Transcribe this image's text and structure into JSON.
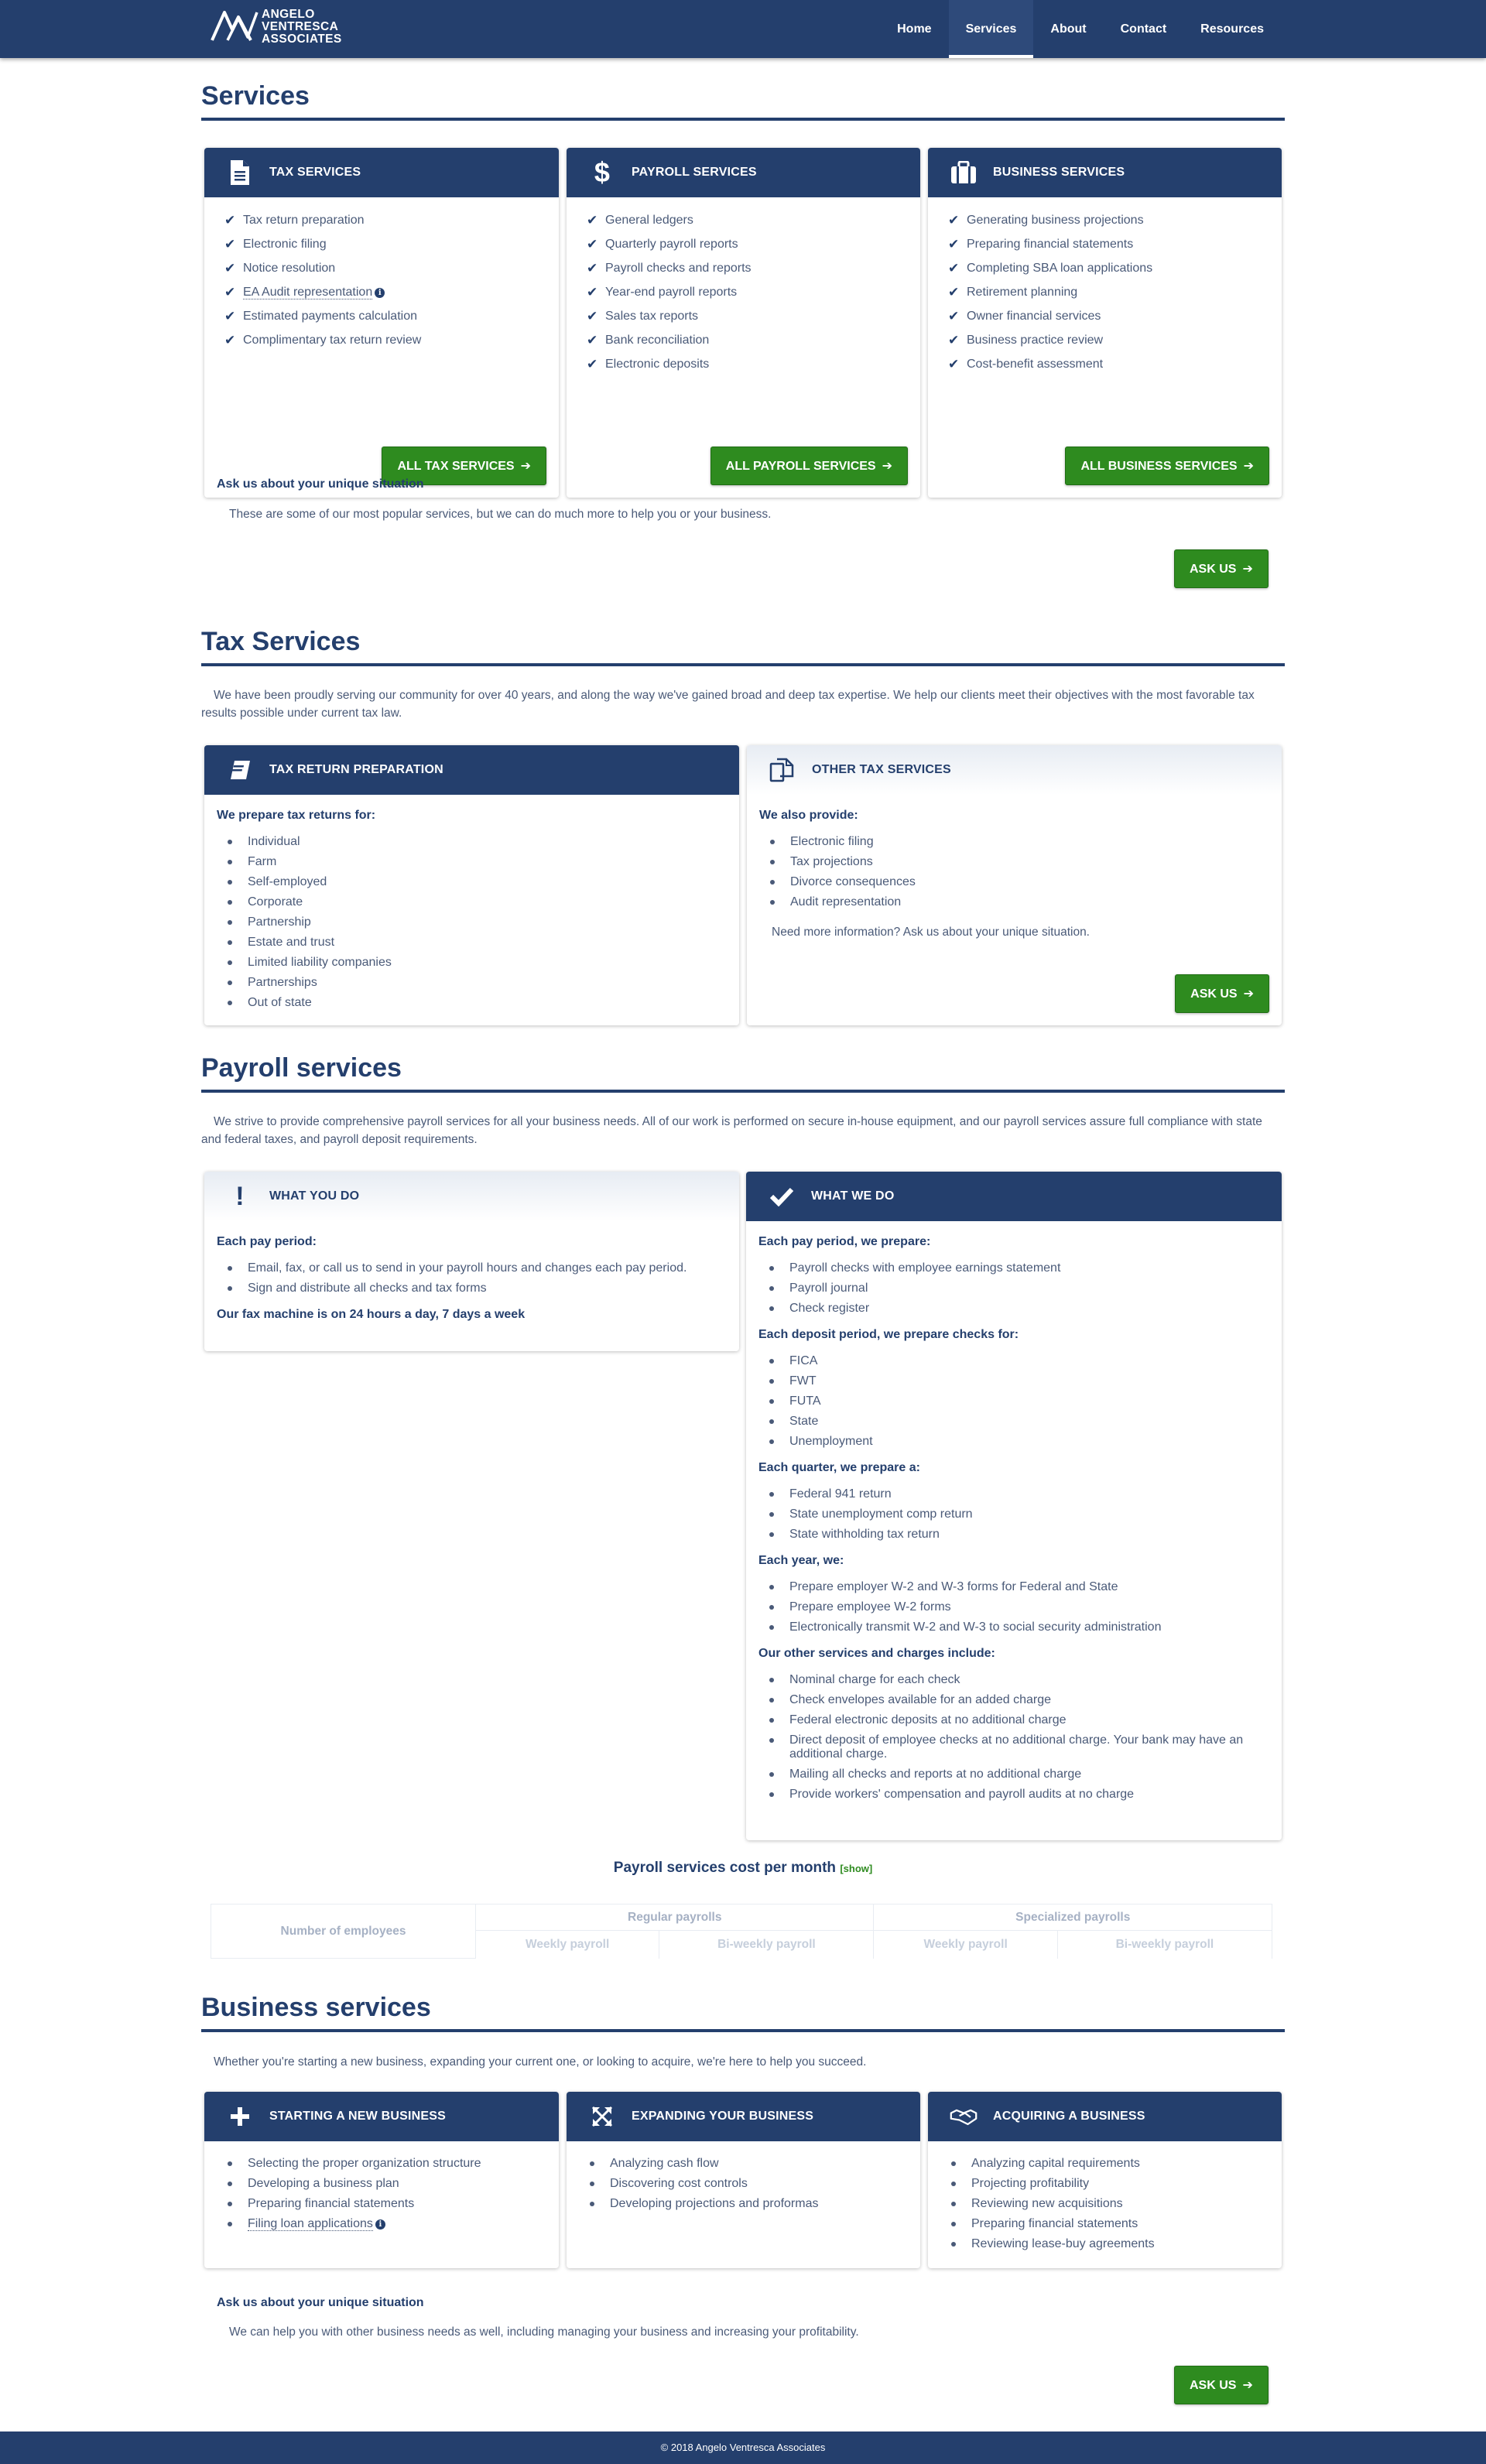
{
  "brand": {
    "line1": "ANGELO",
    "line2": "VENTRESCA",
    "line3": "ASSOCIATES"
  },
  "nav": {
    "home": "Home",
    "services": "Services",
    "about": "About",
    "contact": "Contact",
    "resources": "Resources"
  },
  "overview": {
    "title": "Services",
    "cards": [
      {
        "title": "TAX SERVICES",
        "icon": "document-icon",
        "items": [
          "Tax return preparation",
          "Electronic filing",
          "Notice resolution",
          "EA Audit representation",
          "Estimated payments calculation",
          "Complimentary tax return review"
        ],
        "button": "ALL TAX SERVICES"
      },
      {
        "title": "PAYROLL SERVICES",
        "icon": "dollar-icon",
        "items": [
          "General ledgers",
          "Quarterly payroll reports",
          "Payroll checks and reports",
          "Year-end payroll reports",
          "Sales tax reports",
          "Bank reconciliation",
          "Electronic deposits"
        ],
        "button": "ALL PAYROLL SERVICES"
      },
      {
        "title": "BUSINESS SERVICES",
        "icon": "briefcase-icon",
        "items": [
          "Generating business projections",
          "Preparing financial statements",
          "Completing SBA loan applications",
          "Retirement planning",
          "Owner financial services",
          "Business practice review",
          "Cost-benefit assessment"
        ],
        "button": "ALL BUSINESS SERVICES"
      }
    ],
    "ask_heading": "Ask us about your unique situation",
    "ask_text": "These are some of our most popular services, but we can do much more to help you or your business.",
    "ask_button": "ASK US"
  },
  "tax": {
    "title": "Tax Services",
    "intro": "We have been proudly serving our community for over 40 years, and along the way we've gained broad and deep tax expertise. We help our clients meet their objectives with the most favorable tax results possible under current tax law.",
    "prep": {
      "title": "TAX RETURN PREPARATION",
      "subhead": "We prepare tax returns for:",
      "items": [
        "Individual",
        "Farm",
        "Self-employed",
        "Corporate",
        "Partnership",
        "Estate and trust",
        "Limited liability companies",
        "Partnerships",
        "Out of state"
      ]
    },
    "other": {
      "title": "OTHER TAX SERVICES",
      "subhead": "We also provide:",
      "items": [
        "Electronic filing",
        "Tax projections",
        "Divorce consequences",
        "Audit representation"
      ],
      "note": "Need more information? Ask us about your unique situation.",
      "button": "ASK US"
    }
  },
  "payroll": {
    "title": "Payroll services",
    "intro": "We strive to provide comprehensive payroll services for all your business needs. All of our work is performed on secure in-house equipment, and our payroll services assure full compliance with state and federal taxes, and payroll deposit requirements.",
    "you": {
      "title": "WHAT YOU DO",
      "subhead": "Each pay period:",
      "items": [
        "Email, fax, or call us to send in your payroll hours and changes each pay period.",
        "Sign and distribute all checks and tax forms"
      ],
      "note": "Our fax machine is on 24 hours a day, 7 days a week"
    },
    "we": {
      "title": "WHAT WE DO",
      "groups": [
        {
          "subhead": "Each pay period, we prepare:",
          "items": [
            "Payroll checks with employee earnings statement",
            "Payroll journal",
            "Check register"
          ]
        },
        {
          "subhead": "Each deposit period, we prepare checks for:",
          "items": [
            "FICA",
            "FWT",
            "FUTA",
            "State",
            "Unemployment"
          ]
        },
        {
          "subhead": "Each quarter, we prepare a:",
          "items": [
            "Federal 941 return",
            "State unemployment comp return",
            "State withholding tax return"
          ]
        },
        {
          "subhead": "Each year, we:",
          "items": [
            "Prepare employer W-2 and W-3 forms for Federal and State",
            "Prepare employee W-2 forms",
            "Electronically transmit W-2 and W-3 to social security administration"
          ]
        },
        {
          "subhead": "Our other services and charges include:",
          "items": [
            "Nominal charge for each check",
            "Check envelopes available for an added charge",
            "Federal electronic deposits at no additional charge",
            "Direct deposit of employee checks at no additional charge. Your bank may have an additional charge.",
            "Mailing all checks and reports at no additional charge",
            "Provide workers' compensation and payroll audits at no charge"
          ]
        }
      ]
    },
    "cost": {
      "title": "Payroll services cost per month",
      "show": "[show]",
      "col_employees": "Number of employees",
      "col_regular": "Regular payrolls",
      "col_special": "Specialized payrolls",
      "weekly": "Weekly payroll",
      "biweekly": "Bi-weekly payroll"
    }
  },
  "business": {
    "title": "Business services",
    "intro": "Whether you're starting a new business, expanding your current one, or looking to acquire, we're here to help you succeed.",
    "cards": [
      {
        "title": "STARTING A NEW BUSINESS",
        "icon": "plus-icon",
        "items": [
          "Selecting the proper organization structure",
          "Developing a business plan",
          "Preparing financial statements",
          "Filing loan applications"
        ]
      },
      {
        "title": "EXPANDING YOUR BUSINESS",
        "icon": "expand-icon",
        "items": [
          "Analyzing cash flow",
          "Discovering cost controls",
          "Developing projections and proformas"
        ]
      },
      {
        "title": "ACQUIRING A BUSINESS",
        "icon": "handshake-icon",
        "items": [
          "Analyzing capital requirements",
          "Projecting profitability",
          "Reviewing new acquisitions",
          "Preparing financial statements",
          "Reviewing lease-buy agreements"
        ]
      }
    ],
    "ask_heading": "Ask us about your unique situation",
    "ask_text": "We can help you with other business needs as well, including managing your business and increasing your profitability.",
    "ask_button": "ASK US"
  },
  "footer": {
    "text": "© 2018 Angelo Ventresca Associates"
  }
}
